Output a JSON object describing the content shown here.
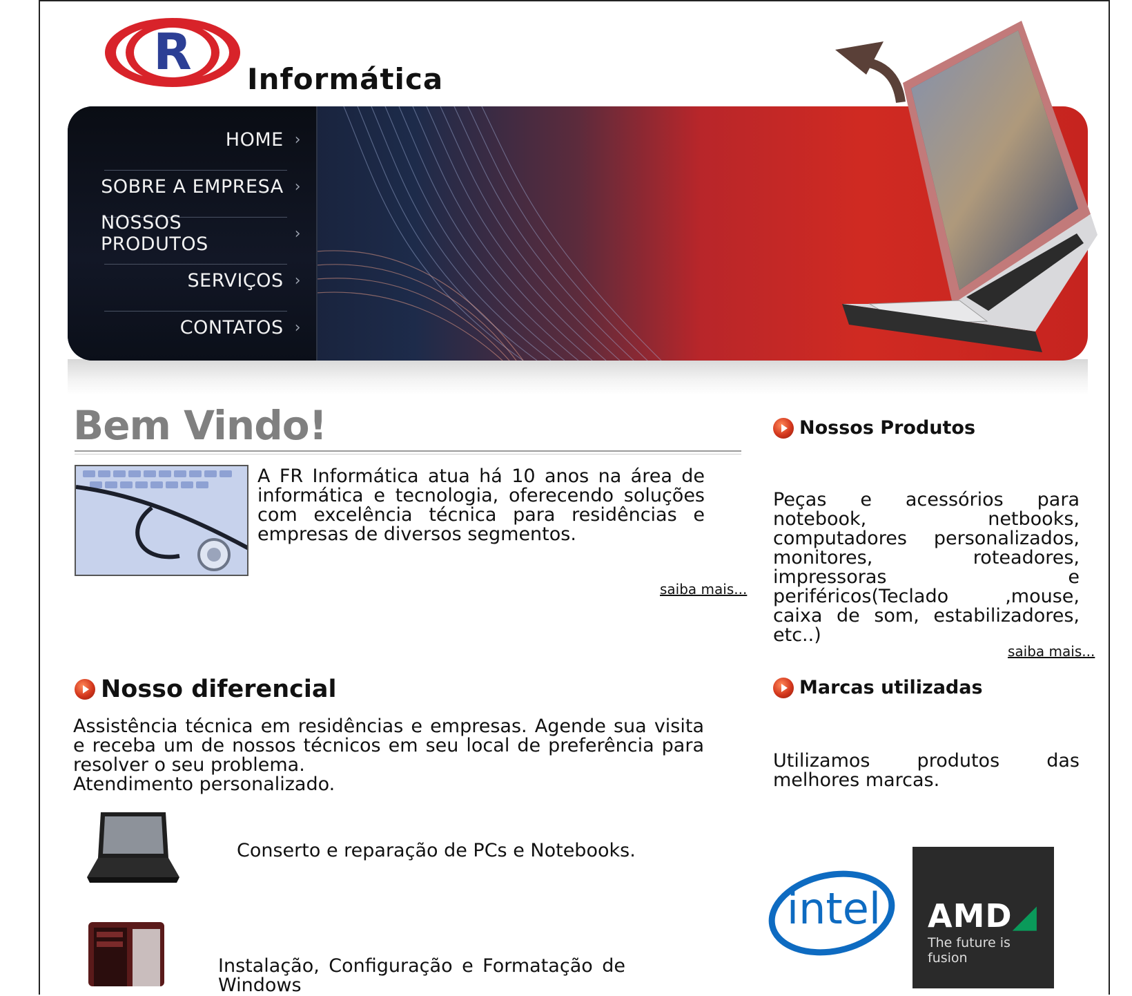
{
  "brand": {
    "logo_letter": "R",
    "logo_word": "Informática"
  },
  "nav": {
    "items": [
      {
        "label": "HOME"
      },
      {
        "label": "SOBRE A EMPRESA"
      },
      {
        "label": "NOSSOS PRODUTOS"
      },
      {
        "label": "SERVIÇOS"
      },
      {
        "label": "CONTATOS"
      }
    ],
    "chevron": "›"
  },
  "welcome": {
    "title": "Bem Vindo!",
    "text": "A FR Informática atua há 10 anos na área de informática e tecnologia, oferecendo soluções com excelência técnica para residências e empresas de diversos segmentos.",
    "more": "saiba mais..."
  },
  "produtos": {
    "heading": "Nossos Produtos",
    "text": "Peças e acessórios para notebook, netbooks, computadores personalizados, monitores, roteadores, impressoras e periféricos(Teclado ,mouse, caixa de som, estabilizadores, etc..)",
    "more": "saiba mais..."
  },
  "diferencial": {
    "heading": "Nosso diferencial",
    "text1": "Assistência técnica em residências e empresas. Agende sua visita e receba um de nossos técnicos em seu local de preferência para resolver o seu problema.",
    "text2": "Atendimento personalizado.",
    "services": [
      {
        "label": "Conserto e reparação de PCs e Notebooks.",
        "icon": "laptop-icon"
      },
      {
        "label": "Instalação, Configuração e Formatação de Windows",
        "icon": "desktop-tower-icon"
      }
    ]
  },
  "marcas": {
    "heading": "Marcas utilizadas",
    "text": "Utilizamos produtos das melhores marcas.",
    "logos": [
      {
        "name": "intel",
        "icon": "intel-logo"
      },
      {
        "name": "AMD",
        "tagline": "The future is fusion",
        "icon": "amd-logo"
      }
    ]
  },
  "colors": {
    "accent_red": "#d02a22",
    "nav_dark": "#0d1322",
    "heading_grey": "#808080"
  }
}
